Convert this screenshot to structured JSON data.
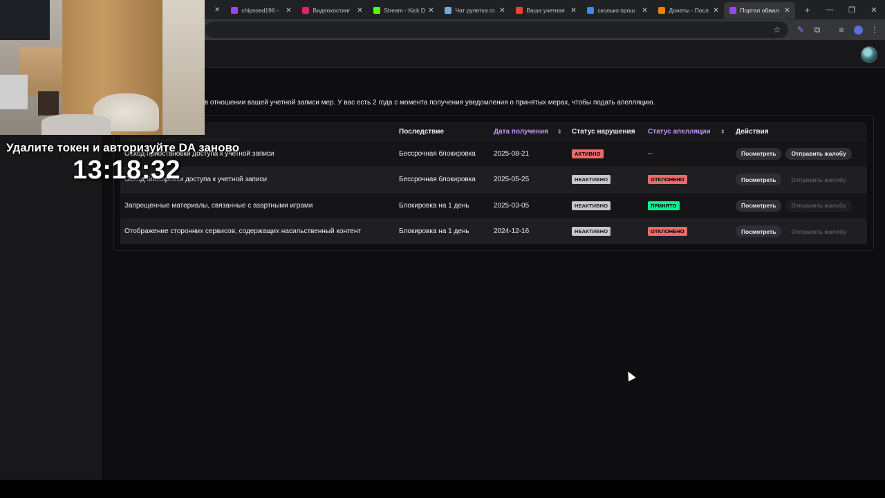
{
  "browser": {
    "tabs": [
      {
        "title": "chipsoed196 -",
        "favicon": "twitch-icon",
        "color": "#9146ff",
        "active": false
      },
      {
        "title": "Видеохостинг",
        "favicon": "rutube-icon",
        "color": "#e0245e",
        "active": false
      },
      {
        "title": "Stream - Kick D",
        "favicon": "kick-icon",
        "color": "#53fc18",
        "active": false
      },
      {
        "title": "Чат рулетка го",
        "favicon": "globe-icon",
        "color": "#7aa7d8",
        "active": false
      },
      {
        "title": "Ваша учетная",
        "favicon": "gmail-icon",
        "color": "#ea4335",
        "active": false
      },
      {
        "title": "сколько прош",
        "favicon": "google-icon",
        "color": "#4285f4",
        "active": false
      },
      {
        "title": "Донаты - Посл",
        "favicon": "donationalerts-icon",
        "color": "#f57c00",
        "active": false
      },
      {
        "title": "Портал обжал",
        "favicon": "twitch-icon",
        "color": "#9146ff",
        "active": true
      }
    ]
  },
  "page": {
    "intro": "х в отношении вашей учетной записи мер. У вас есть 2 года с момента получения уведомления о принятых мерах, чтобы подать апелляцию.",
    "columns": {
      "consequence": "Последствие",
      "date": "Дата получения",
      "violation_status": "Статус нарушения",
      "appeal_status": "Статус апелляции",
      "actions": "Действия"
    },
    "rows": [
      {
        "reason": "Обход приостановки доступа к учетной записи",
        "consequence": "Бессрочная блокировка",
        "date": "2025-08-21",
        "violation": "АКТИВНО",
        "violation_kind": "red",
        "appeal": "--",
        "appeal_kind": "none",
        "view": "Посмотреть",
        "complain": "Отправить жалобу",
        "complain_enabled": true
      },
      {
        "reason": "Обход блокировки доступа к учетной записи",
        "consequence": "Бессрочная блокировка",
        "date": "2025-05-25",
        "violation": "НЕАКТИВНО",
        "violation_kind": "gray",
        "appeal": "ОТКЛОНЕНО",
        "appeal_kind": "red",
        "view": "Посмотреть",
        "complain": "Отправить жалобу",
        "complain_enabled": false
      },
      {
        "reason": "Запрещенные материалы, связанные с азартными играми",
        "consequence": "Блокировка на 1 день",
        "date": "2025-03-05",
        "violation": "НЕАКТИВНО",
        "violation_kind": "gray",
        "appeal": "ПРИНЯТО",
        "appeal_kind": "green",
        "view": "Посмотреть",
        "complain": "Отправить жалобу",
        "complain_enabled": false
      },
      {
        "reason": "Отображение сторонних сервисов, содержащих насильственный контент",
        "consequence": "Блокировка на 1 день",
        "date": "2024-12-16",
        "violation": "НЕАКТИВНО",
        "violation_kind": "gray",
        "appeal": "ОТКЛОНЕНО",
        "appeal_kind": "red",
        "view": "Посмотреть",
        "complain": "Отправить жалобу",
        "complain_enabled": false
      }
    ]
  },
  "overlay": {
    "message": "Удалите токен и авторизуйте DA заново",
    "clock": "13:18:32"
  }
}
